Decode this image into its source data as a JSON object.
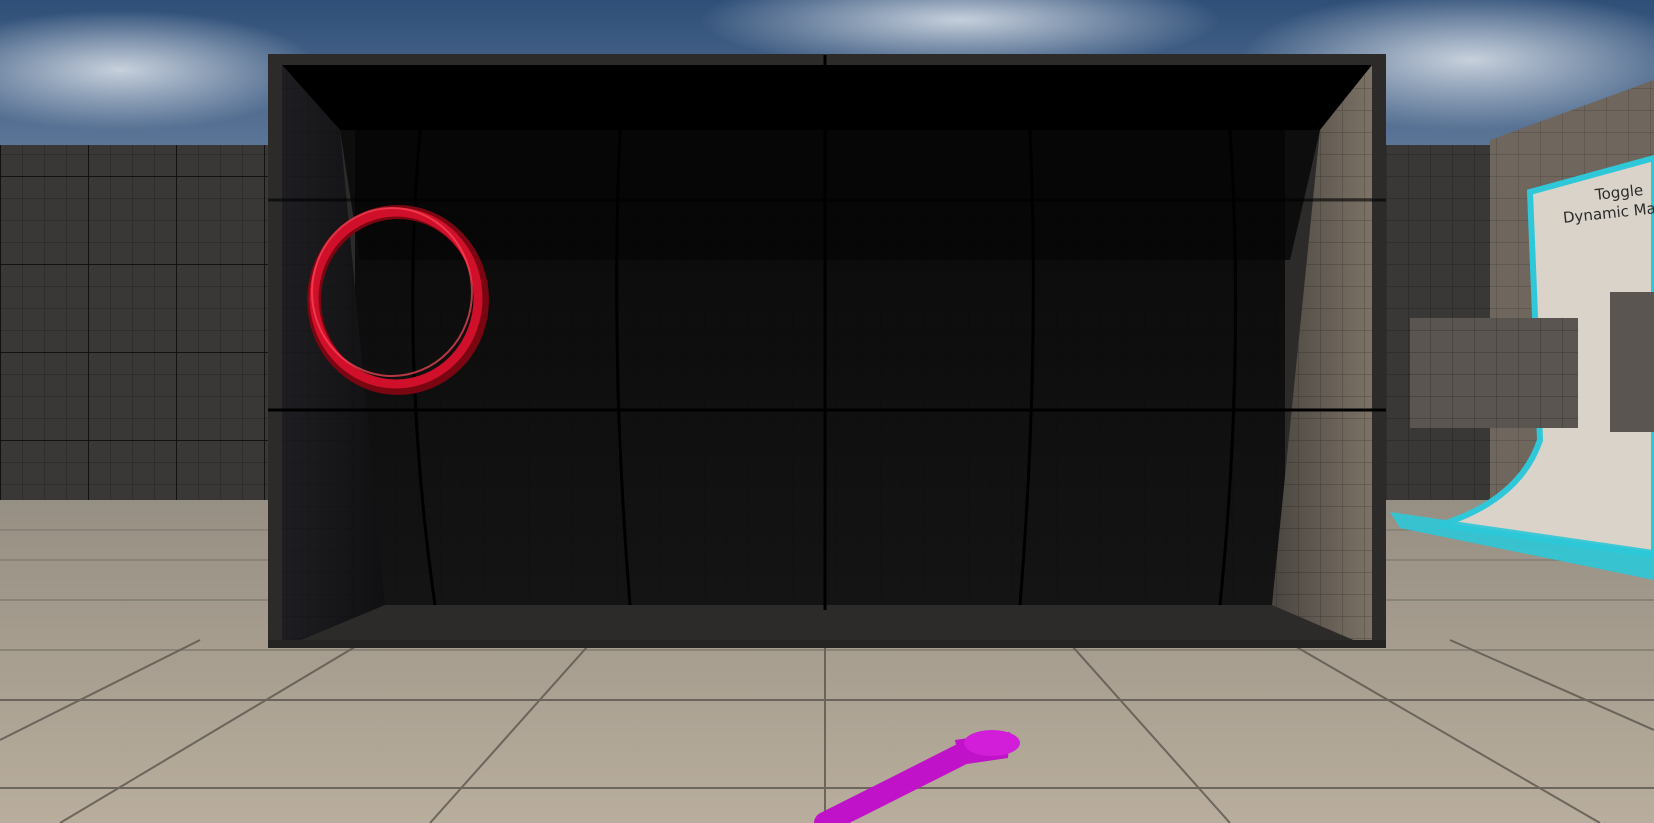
{
  "scene": {
    "type": "first-person 3D VR level viewport",
    "sign": {
      "line1": "Toggle",
      "line2": "Dynamic Mater",
      "border_color": "#2ec8d8"
    },
    "ring_color": "#d0102a",
    "pointer_color": "#c012c8",
    "colors": {
      "sky": "#3b5b82",
      "floor": "#b1a796",
      "wall": "#3a3836",
      "frame": "#2c2b2a",
      "interior": "#121212"
    }
  }
}
